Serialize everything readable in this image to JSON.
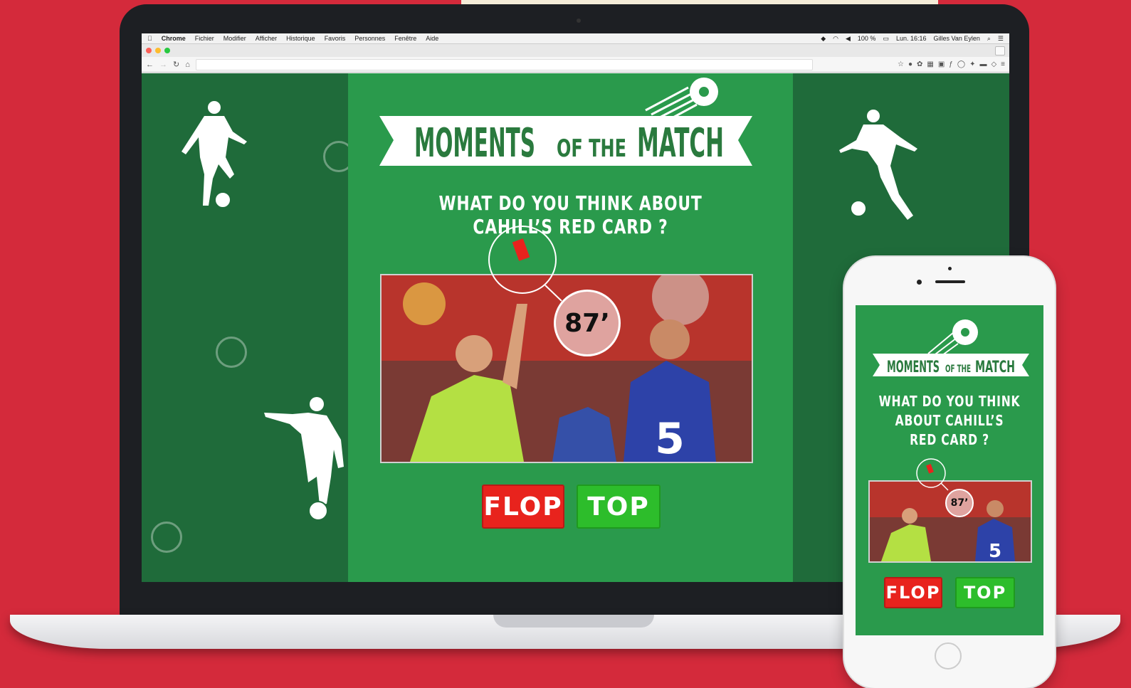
{
  "menubar": {
    "apple": "",
    "app": "Chrome",
    "items": [
      "Fichier",
      "Modifier",
      "Afficher",
      "Historique",
      "Favoris",
      "Personnes",
      "Fenêtre",
      "Aide"
    ],
    "battery": "100 %",
    "clock": "Lun. 16:16",
    "user": "Gilles Van Eylen"
  },
  "toolbar": {
    "back": "←",
    "forward": "→",
    "reload": "↻",
    "home": "⌂",
    "menu": "≡"
  },
  "page": {
    "title_moments": "MOMENTS",
    "title_of_the": "OF THE",
    "title_match": "MATCH",
    "question": "WHAT DO YOU THINK ABOUT CAHILL’S RED CARD ?",
    "minute": "87’",
    "flop_label": "FLOP",
    "top_label": "TOP"
  },
  "mobile": {
    "title_moments": "MOMENTS",
    "title_of_the": "OF THE",
    "title_match": "MATCH",
    "question_lines": [
      "WHAT DO YOU THINK",
      "ABOUT CAHILL’S",
      "RED CARD ?"
    ],
    "minute": "87’",
    "flop_label": "FLOP",
    "top_label": "TOP"
  },
  "colors": {
    "background": "#d42a3b",
    "page_green": "#2a9a4c",
    "dark_green": "#1f6b3a",
    "flop_red": "#e8231d",
    "top_green": "#2dbd2b"
  }
}
